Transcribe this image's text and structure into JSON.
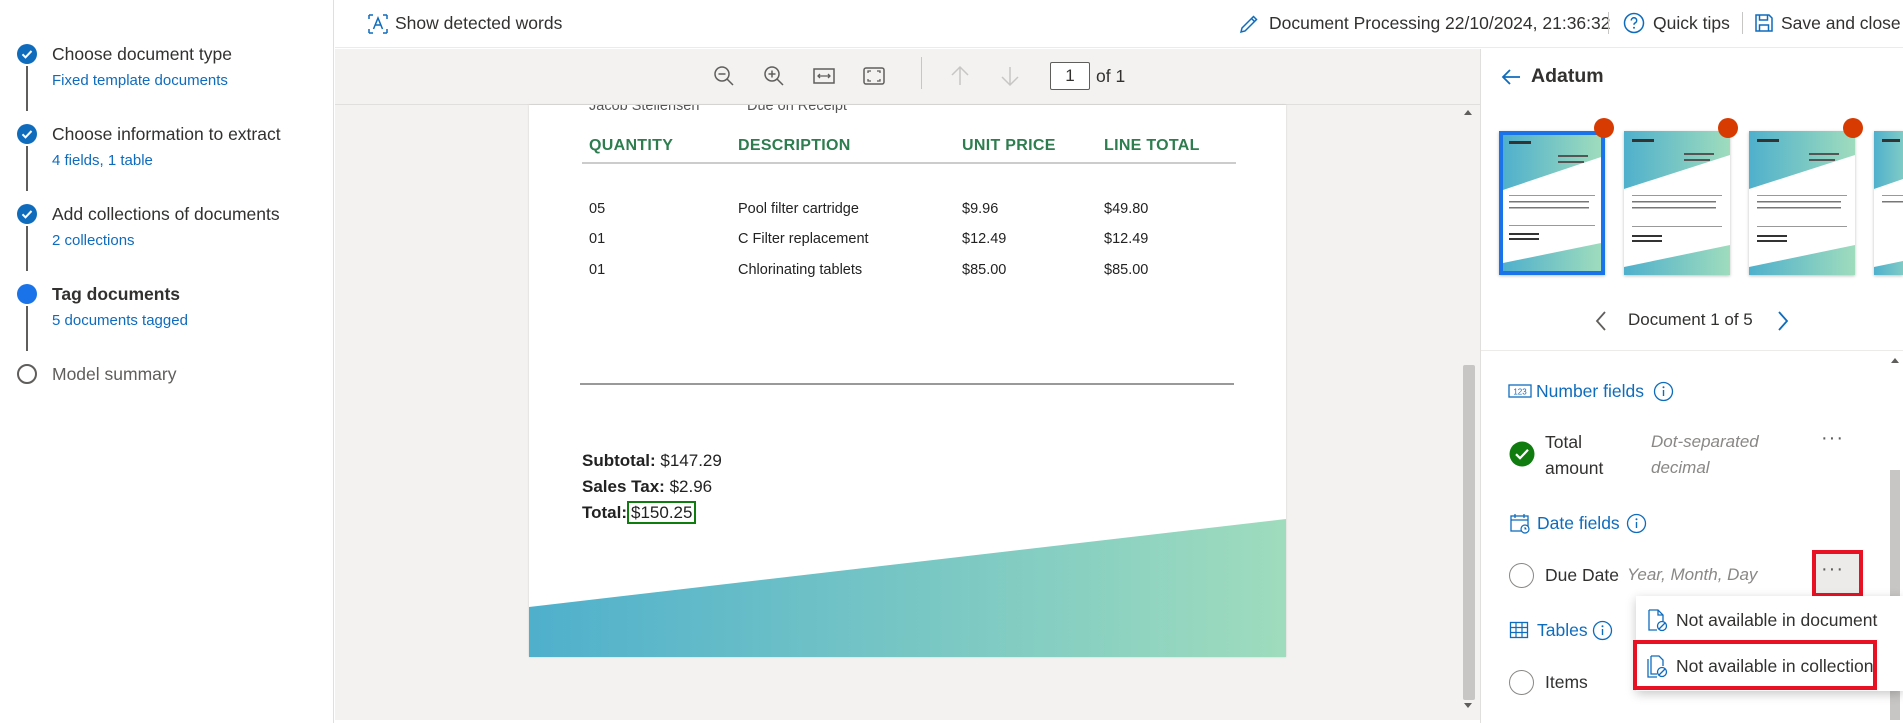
{
  "stepper": {
    "steps": [
      {
        "title": "Choose document type",
        "subtitle": "Fixed template documents",
        "state": "done"
      },
      {
        "title": "Choose information to extract",
        "subtitle": "4 fields, 1 table",
        "state": "done"
      },
      {
        "title": "Add collections of documents",
        "subtitle": "2 collections",
        "state": "done"
      },
      {
        "title": "Tag documents",
        "subtitle": "5 documents tagged",
        "state": "current"
      },
      {
        "title": "Model summary",
        "subtitle": "",
        "state": "todo"
      }
    ]
  },
  "topbar": {
    "show_detected_words": "Show detected words",
    "document_processing": "Document Processing 22/10/2024, 21:36:32",
    "quick_tips": "Quick tips",
    "save_and_close": "Save and close"
  },
  "viewer": {
    "page_number": "1",
    "page_of": "of 1",
    "document": {
      "partial_top_left": "Jacob Stellensen",
      "partial_top_right": "Due on Receipt",
      "headers": [
        "QUANTITY",
        "DESCRIPTION",
        "UNIT PRICE",
        "LINE TOTAL"
      ],
      "rows": [
        [
          "05",
          "Pool filter cartridge",
          "$9.96",
          "$49.80"
        ],
        [
          "01",
          "C Filter replacement",
          "$12.49",
          "$12.49"
        ],
        [
          "01",
          "Chlorinating tablets",
          "$85.00",
          "$85.00"
        ]
      ],
      "subtotal_label": "Subtotal:",
      "subtotal_value": "$147.29",
      "sales_tax_label": "Sales Tax:",
      "sales_tax_value": "$2.96",
      "total_label": "Total:",
      "total_value": "$150.25"
    }
  },
  "right_panel": {
    "title": "Adatum",
    "document_nav": "Document 1 of 5",
    "number_fields_heading": "Number fields",
    "total_amount_label_1": "Total",
    "total_amount_label_2": "amount",
    "total_amount_hint_1": "Dot-separated",
    "total_amount_hint_2": "decimal",
    "date_fields_heading": "Date fields",
    "due_date_label": "Due Date",
    "due_date_hint": "Year, Month, Day",
    "tables_heading": "Tables",
    "items_label": "Items",
    "more_glyph": "···"
  },
  "menu": {
    "items": [
      "Not available in document",
      "Not available in collection"
    ]
  },
  "colors": {
    "accent": "#0f6cbd",
    "step_blue": "#1a73e8",
    "success": "#107c10",
    "badge": "#d83b01",
    "highlight": "#e81123",
    "doc_header": "#2e7d4f"
  }
}
